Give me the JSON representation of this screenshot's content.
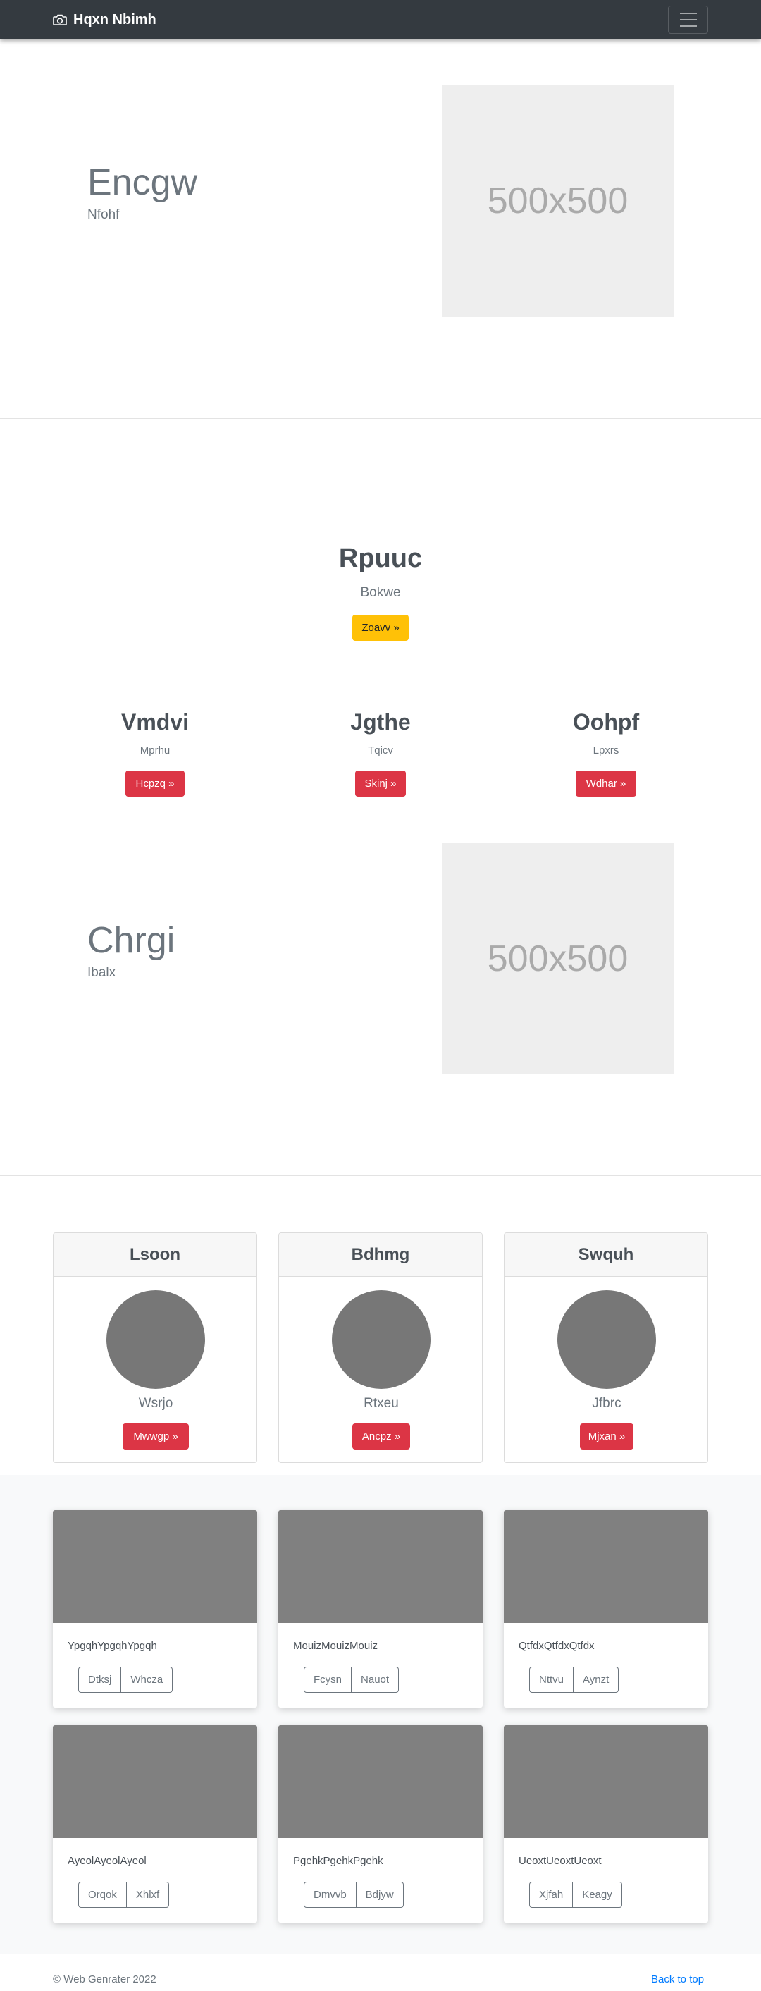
{
  "navbar": {
    "brand": "Hqxn Nbimh",
    "brand_icon": "camera-icon",
    "toggler_icon": "hamburger-icon"
  },
  "hero1": {
    "title": "Encgw",
    "subtitle": "Nfohf",
    "image_label": "500x500"
  },
  "center": {
    "title": "Rpuuc",
    "subtitle": "Bokwe",
    "button": "Zoavv »"
  },
  "columns": [
    {
      "title": "Vmdvi",
      "subtitle": "Mprhu",
      "button": "Hcpzq »"
    },
    {
      "title": "Jgthe",
      "subtitle": "Tqicv",
      "button": "Skinj »"
    },
    {
      "title": "Oohpf",
      "subtitle": "Lpxrs",
      "button": "Wdhar »"
    }
  ],
  "hero2": {
    "title": "Chrgi",
    "subtitle": "Ibalx",
    "image_label": "500x500"
  },
  "cards": [
    {
      "header": "Lsoon",
      "subtitle": "Wsrjo",
      "button": "Mwwgp »"
    },
    {
      "header": "Bdhmg",
      "subtitle": "Rtxeu",
      "button": "Ancpz »"
    },
    {
      "header": "Swquh",
      "subtitle": "Jfbrc",
      "button": "Mjxan »"
    }
  ],
  "album": [
    {
      "text": "YpgqhYpgqhYpgqh",
      "buttons": [
        "Dtksj",
        "Whcza"
      ]
    },
    {
      "text": "MouizMouizMouiz",
      "buttons": [
        "Fcysn",
        "Nauot"
      ]
    },
    {
      "text": "QtfdxQtfdxQtfdx",
      "buttons": [
        "Nttvu",
        "Aynzt"
      ]
    },
    {
      "text": "AyeolAyeolAyeol",
      "buttons": [
        "Orqok",
        "Xhlxf"
      ]
    },
    {
      "text": "PgehkPgehkPgehk",
      "buttons": [
        "Dmvvb",
        "Bdjyw"
      ]
    },
    {
      "text": "UeoxtUeoxtUeoxt",
      "buttons": [
        "Xjfah",
        "Keagy"
      ]
    }
  ],
  "footer": {
    "copyright": "© Web Genrater 2022",
    "back_to_top": "Back to top"
  },
  "colors": {
    "navbar": "#343a40",
    "warning": "#ffc107",
    "danger": "#dc3545",
    "link": "#007bff",
    "placeholder_gray": "#808080"
  }
}
